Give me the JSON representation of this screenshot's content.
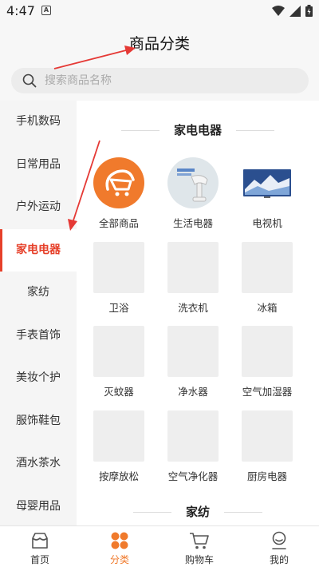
{
  "status": {
    "time": "4:47",
    "notif_letter": "A"
  },
  "header": {
    "title": "商品分类"
  },
  "search": {
    "placeholder": "搜索商品名称"
  },
  "sidebar": {
    "items": [
      {
        "label": "手机数码"
      },
      {
        "label": "日常用品"
      },
      {
        "label": "户外运动"
      },
      {
        "label": "家电电器",
        "active": true
      },
      {
        "label": "家纺"
      },
      {
        "label": "手表首饰"
      },
      {
        "label": "美妆个护"
      },
      {
        "label": "服饰鞋包"
      },
      {
        "label": "酒水茶水"
      },
      {
        "label": "母婴用品"
      }
    ]
  },
  "main": {
    "section1_title": "家电电器",
    "items": [
      {
        "label": "全部商品",
        "icon": "all-products-icon"
      },
      {
        "label": "生活电器",
        "icon": "steamer-image"
      },
      {
        "label": "电视机",
        "icon": "tv-image"
      },
      {
        "label": "卫浴"
      },
      {
        "label": "洗衣机"
      },
      {
        "label": "冰箱"
      },
      {
        "label": "灭蚊器"
      },
      {
        "label": "净水器"
      },
      {
        "label": "空气加湿器"
      },
      {
        "label": "按摩放松"
      },
      {
        "label": "空气净化器"
      },
      {
        "label": "厨房电器"
      }
    ],
    "section2_title": "家纺"
  },
  "nav": {
    "items": [
      {
        "label": "首页",
        "icon": "home-icon"
      },
      {
        "label": "分类",
        "icon": "category-icon",
        "active": true
      },
      {
        "label": "购物车",
        "icon": "cart-icon"
      },
      {
        "label": "我的",
        "icon": "profile-icon"
      }
    ]
  },
  "colors": {
    "accent": "#e6402a",
    "nav_active": "#f07a2c",
    "all_icon_bg": "#f07a2c",
    "annotation_arrow": "#e53935"
  }
}
